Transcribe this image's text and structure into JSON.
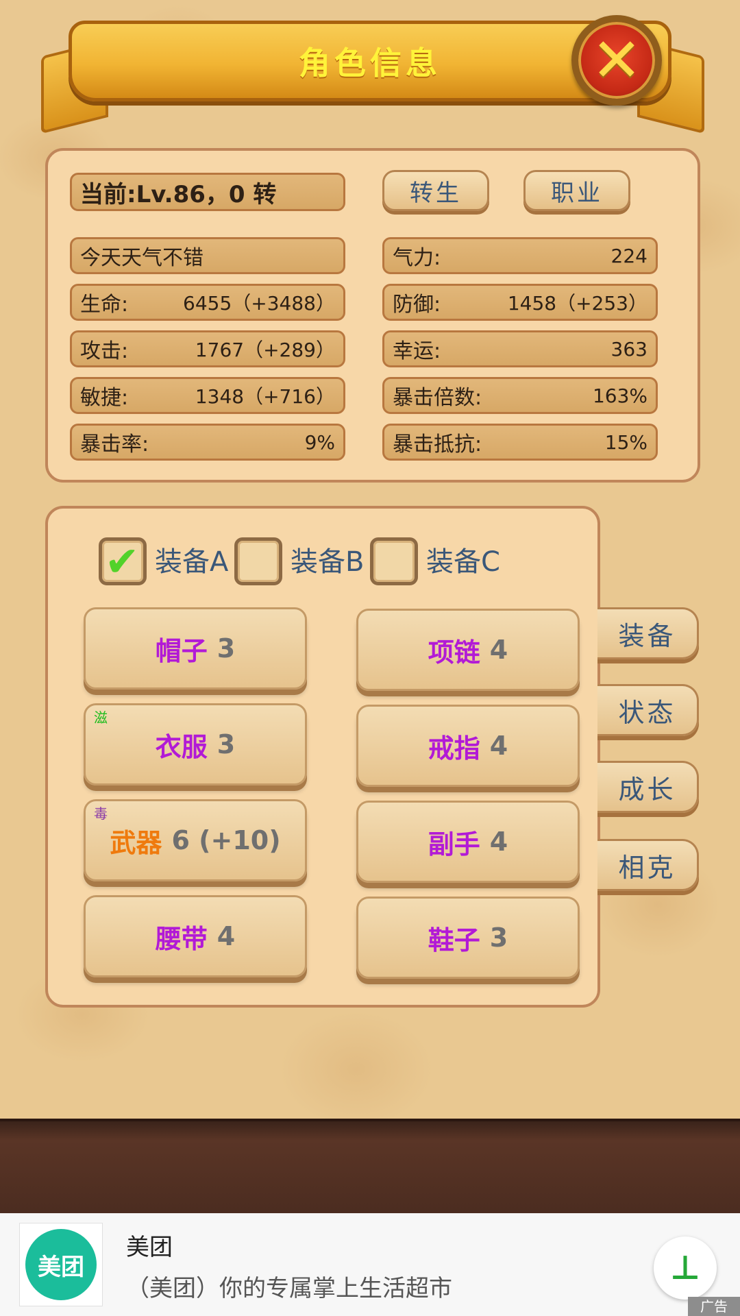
{
  "header": {
    "title": "角色信息",
    "close_icon": "close-x-icon"
  },
  "level": {
    "text": "当前:Lv.86，0 转"
  },
  "buttons": {
    "rebirth": "转生",
    "profession": "职业"
  },
  "stats_left": [
    {
      "label": "今天天气不错",
      "value": ""
    },
    {
      "label": "生命:",
      "value": "6455（+3488）"
    },
    {
      "label": "攻击:",
      "value": "1767（+289）"
    },
    {
      "label": "敏捷:",
      "value": "1348（+716）"
    },
    {
      "label": "暴击率:",
      "value": "9%"
    }
  ],
  "stats_right": [
    {
      "label": "气力:",
      "value": "224"
    },
    {
      "label": "防御:",
      "value": "1458（+253）"
    },
    {
      "label": "幸运:",
      "value": "363"
    },
    {
      "label": "暴击倍数:",
      "value": "163%"
    },
    {
      "label": "暴击抵抗:",
      "value": "15%"
    }
  ],
  "equip_sets": [
    {
      "label": "装备A",
      "checked": true
    },
    {
      "label": "装备B",
      "checked": false
    },
    {
      "label": "装备C",
      "checked": false
    }
  ],
  "slots": [
    {
      "name": "帽子",
      "level": "3",
      "tag": ""
    },
    {
      "name": "项链",
      "level": "4",
      "tag": ""
    },
    {
      "name": "衣服",
      "level": "3",
      "tag": "滋"
    },
    {
      "name": "戒指",
      "level": "4",
      "tag": ""
    },
    {
      "name": "武器",
      "level": "6 (+10)",
      "tag": "毒"
    },
    {
      "name": "副手",
      "level": "4",
      "tag": ""
    },
    {
      "name": "腰带",
      "level": "4",
      "tag": ""
    },
    {
      "name": "鞋子",
      "level": "3",
      "tag": ""
    }
  ],
  "side_tabs": [
    "装备",
    "状态",
    "成长",
    "相克"
  ],
  "colors": {
    "slot_name": "#b21ad6",
    "weapon_name": "#ef7a0d",
    "title": "#fff33a"
  },
  "ad": {
    "logo_text": "美团",
    "title": "美团",
    "description": "（美团）你的专属掌上生活超市",
    "download_icon": "download-icon",
    "badge": "广告"
  }
}
